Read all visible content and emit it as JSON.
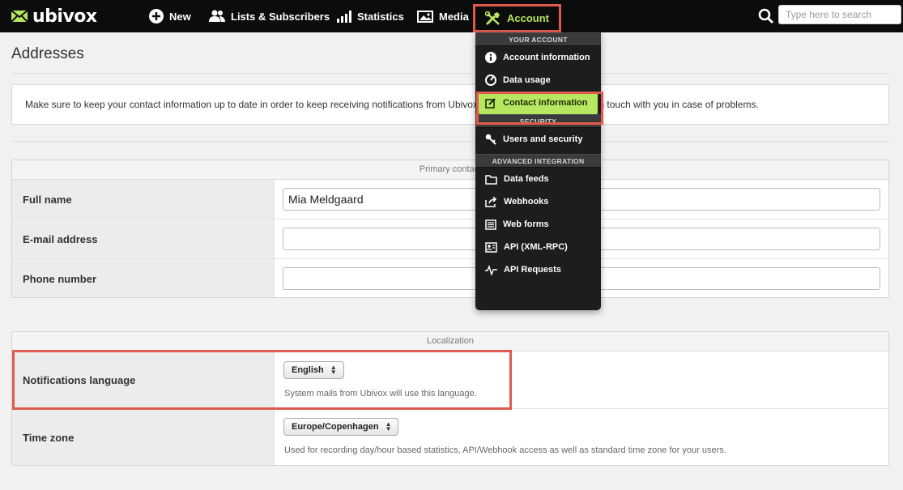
{
  "brand": {
    "name": "ubivox"
  },
  "nav": {
    "new": "New",
    "lists": "Lists & Subscribers",
    "statistics": "Statistics",
    "media": "Media",
    "account": "Account"
  },
  "search": {
    "placeholder": "Type here to search"
  },
  "page": {
    "title": "Addresses",
    "notice": "Make sure to keep your contact information up to date in order to keep receiving notifications from Ubivox and allowing Ubivox to get in touch with you in case of problems."
  },
  "primary_contact": {
    "heading": "Primary contact",
    "full_name_label": "Full name",
    "full_name_value": "Mia Meldgaard",
    "email_label": "E-mail address",
    "email_value": "",
    "phone_label": "Phone number",
    "phone_value": ""
  },
  "localization": {
    "heading": "Localization",
    "language_label": "Notifications language",
    "language_value": "English",
    "language_hint": "System mails from Ubivox will use this language.",
    "timezone_label": "Time zone",
    "timezone_value": "Europe/Copenhagen",
    "timezone_hint": "Used for recording day/hour based statistics, API/Webhook access as well as standard time zone for your users."
  },
  "account_menu": {
    "section_account": "YOUR ACCOUNT",
    "account_information": "Account information",
    "data_usage": "Data usage",
    "contact_information": "Contact information",
    "section_security": "SECURITY",
    "users_and_security": "Users and security",
    "section_integration": "ADVANCED INTEGRATION",
    "data_feeds": "Data feeds",
    "webhooks": "Webhooks",
    "web_forms": "Web forms",
    "api_xmlrpc": "API (XML-RPC)",
    "api_requests": "API Requests"
  },
  "colors": {
    "accent": "#b7e760",
    "highlight": "#e05a4d",
    "topbar": "#0c0c0c"
  }
}
